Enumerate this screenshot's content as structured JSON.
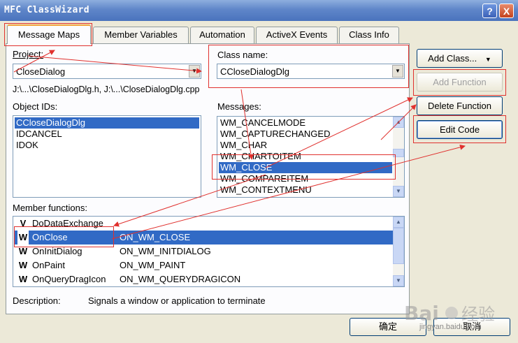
{
  "window": {
    "title": "MFC ClassWizard",
    "help_label": "?",
    "close_label": "X"
  },
  "tabs": [
    {
      "label": "Message Maps",
      "active": true
    },
    {
      "label": "Member Variables",
      "active": false
    },
    {
      "label": "Automation",
      "active": false
    },
    {
      "label": "ActiveX Events",
      "active": false
    },
    {
      "label": "Class Info",
      "active": false
    }
  ],
  "project": {
    "label": "Project:",
    "value": "CloseDialog"
  },
  "class_name": {
    "label": "Class name:",
    "value": "CCloseDialogDlg"
  },
  "file_path": "J:\\...\\CloseDialogDlg.h, J:\\...\\CloseDialogDlg.cpp",
  "object_ids": {
    "label": "Object IDs:",
    "items": [
      "CCloseDialogDlg",
      "IDCANCEL",
      "IDOK"
    ],
    "selected": 0
  },
  "messages": {
    "label": "Messages:",
    "items": [
      "WM_CANCELMODE",
      "WM_CAPTURECHANGED",
      "WM_CHAR",
      "WM_CHARTOITEM",
      "WM_CLOSE",
      "WM_COMPAREITEM",
      "WM_CONTEXTMENU"
    ],
    "selected": 4
  },
  "buttons": {
    "add_class": "Add Class...",
    "add_class_arrow": "▼",
    "add_function": "Add Function",
    "delete_function": "Delete Function",
    "edit_code": "Edit Code"
  },
  "member_functions": {
    "label": "Member functions:",
    "rows": [
      {
        "flag": "V",
        "name": "DoDataExchange",
        "message": ""
      },
      {
        "flag": "W",
        "name": "OnClose",
        "message": "ON_WM_CLOSE"
      },
      {
        "flag": "W",
        "name": "OnInitDialog",
        "message": "ON_WM_INITDIALOG"
      },
      {
        "flag": "W",
        "name": "OnPaint",
        "message": "ON_WM_PAINT"
      },
      {
        "flag": "W",
        "name": "OnQueryDragIcon",
        "message": "ON_WM_QUERYDRAGICON"
      }
    ],
    "selected": 1
  },
  "description": {
    "label": "Description:",
    "text": "Signals a window or application to terminate"
  },
  "footer": {
    "ok": "确定",
    "cancel": "取消"
  },
  "watermark": {
    "brand": "Bai",
    "brand2": "经验",
    "sub": "jingyan.baidu.com"
  },
  "colors": {
    "selection": "#316ac5",
    "annotation": "#e0312e",
    "titlebar": "#4a73bd"
  }
}
